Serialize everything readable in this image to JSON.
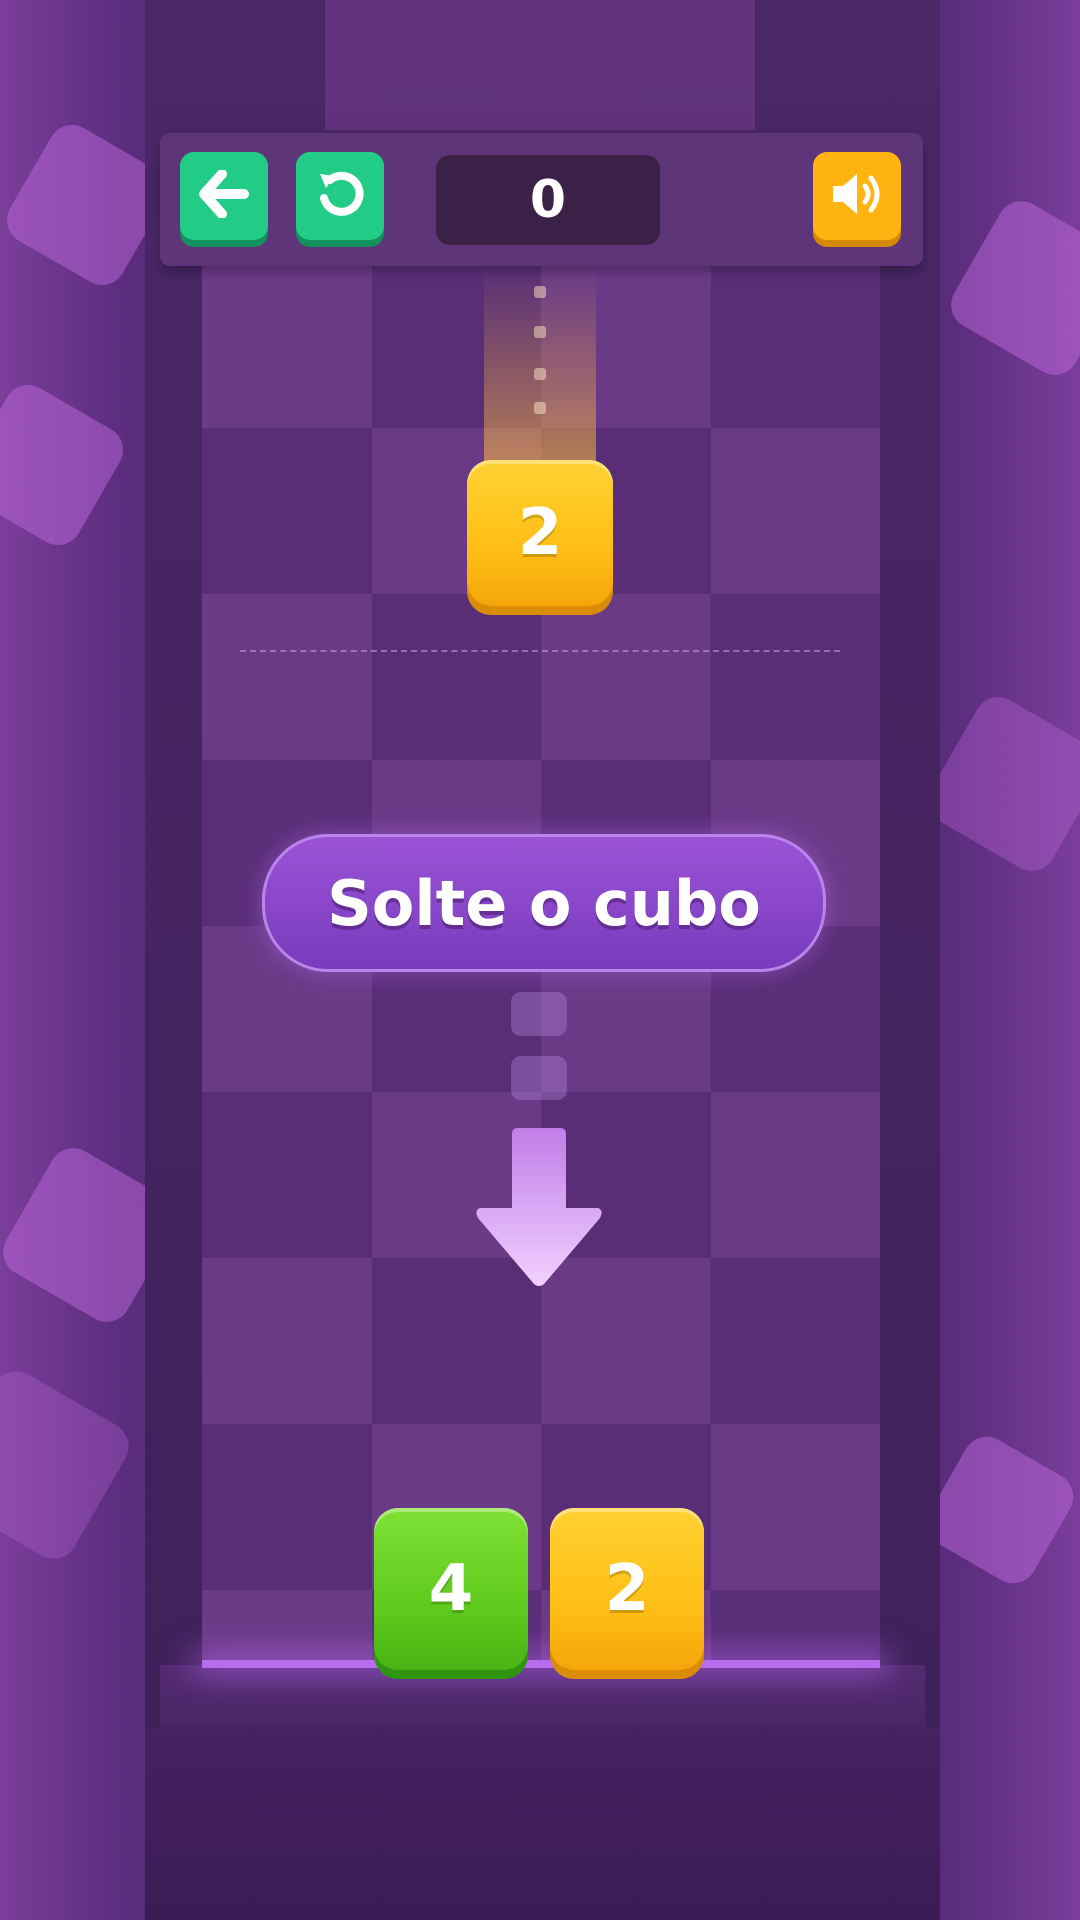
{
  "toolbar": {
    "back_icon": "arrow-left-icon",
    "restart_icon": "restart-icon",
    "score": "0",
    "sound_icon": "speaker-on-icon",
    "colors": {
      "green_button": "#22cc86",
      "yellow_button": "#ffb412"
    }
  },
  "falling_cube": {
    "value": "2",
    "color": "#ffbf15"
  },
  "hint": {
    "text": "Solte o cubo",
    "arrow_icon": "arrow-down-icon"
  },
  "stack": [
    {
      "value": "4",
      "color": "#5fcb1d"
    },
    {
      "value": "2",
      "color": "#ffbf15"
    }
  ]
}
